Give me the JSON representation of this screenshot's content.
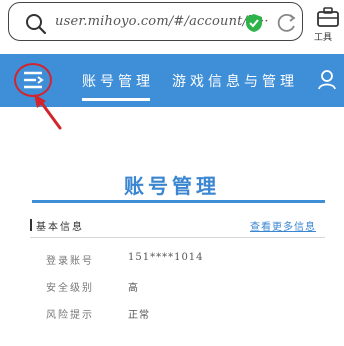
{
  "browser": {
    "url": "user.mihoyo.com/#/account/h···",
    "tools_label": "工具"
  },
  "nav": {
    "tabs": [
      {
        "label": "账号管理"
      },
      {
        "label": "游戏信息与管理"
      }
    ],
    "bar_color": "#3f8fd8"
  },
  "page": {
    "title": "账号管理",
    "section_title": "基本信息",
    "more_link": "查看更多信息",
    "rows": [
      {
        "label": "登录账号",
        "value": "151****1014"
      },
      {
        "label": "安全级别",
        "value": "高"
      },
      {
        "label": "风险提示",
        "value": "正常"
      }
    ]
  },
  "annotation_color": "#d3242b"
}
